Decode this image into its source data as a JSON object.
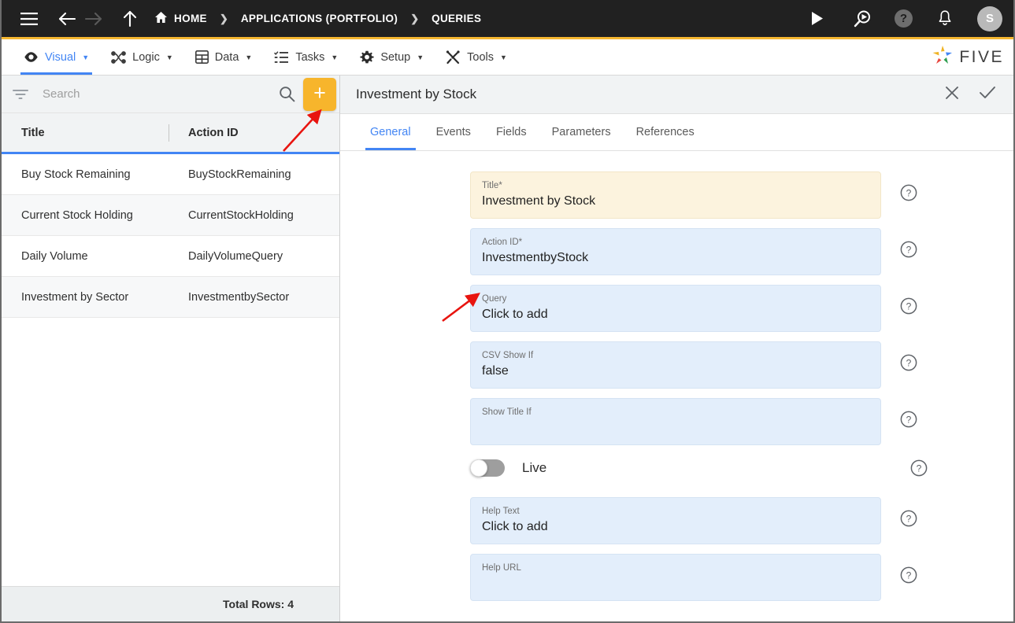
{
  "topbar": {
    "menu_icon": "hamburger-menu-icon",
    "back_icon": "arrow-left-icon",
    "forward_icon": "arrow-right-icon",
    "up_icon": "arrow-up-icon",
    "home_icon": "home-icon",
    "breadcrumbs": [
      {
        "label": "HOME",
        "icon": "home-icon"
      },
      {
        "label": "APPLICATIONS (PORTFOLIO)",
        "icon": ""
      },
      {
        "label": "QUERIES",
        "icon": ""
      }
    ],
    "separator": "❯",
    "actions": [
      {
        "name": "run-icon",
        "glyph": "▶"
      },
      {
        "name": "search-run-icon",
        "glyph": ""
      },
      {
        "name": "help-icon",
        "glyph": "?"
      },
      {
        "name": "notifications-bell-icon",
        "glyph": ""
      }
    ],
    "avatar_initial": "S"
  },
  "menubar": {
    "items": [
      {
        "label": "Visual",
        "icon": "eye-icon",
        "caret": "▼",
        "active": true
      },
      {
        "label": "Logic",
        "icon": "nodes-icon",
        "caret": "▼",
        "active": false
      },
      {
        "label": "Data",
        "icon": "table-icon",
        "caret": "▼",
        "active": false
      },
      {
        "label": "Tasks",
        "icon": "checklist-icon",
        "caret": "▼",
        "active": false
      },
      {
        "label": "Setup",
        "icon": "gear-icon",
        "caret": "▼",
        "active": false
      },
      {
        "label": "Tools",
        "icon": "tools-icon",
        "caret": "▼",
        "active": false
      }
    ],
    "brand": "FIVE",
    "accent_color": "#f5b731",
    "active_color": "#4285f4"
  },
  "sidebar": {
    "filter_icon": "filter-icon",
    "search_placeholder": "Search",
    "search_value": "",
    "search_icon": "search-icon",
    "add_button_label": "+",
    "add_button_color": "#f7b52c",
    "columns": [
      "Title",
      "Action ID"
    ],
    "rows": [
      {
        "title": "Buy Stock Remaining",
        "action_id": "BuyStockRemaining"
      },
      {
        "title": "Current Stock Holding",
        "action_id": "CurrentStockHolding"
      },
      {
        "title": "Daily Volume",
        "action_id": "DailyVolumeQuery"
      },
      {
        "title": "Investment by Sector",
        "action_id": "InvestmentbySector"
      }
    ],
    "footer": "Total Rows: 4"
  },
  "detail": {
    "title": "Investment by Stock",
    "close_icon": "close-icon",
    "confirm_icon": "check-icon",
    "tabs": [
      {
        "label": "General",
        "active": true
      },
      {
        "label": "Events",
        "active": false
      },
      {
        "label": "Fields",
        "active": false
      },
      {
        "label": "Parameters",
        "active": false
      },
      {
        "label": "References",
        "active": false
      }
    ],
    "fields": [
      {
        "label": "Title",
        "required": true,
        "value": "Investment by Stock",
        "highlight": true,
        "name": "title-field"
      },
      {
        "label": "Action ID",
        "required": true,
        "value": "InvestmentbyStock",
        "highlight": false,
        "name": "action-id-field"
      },
      {
        "label": "Query",
        "required": false,
        "value": "Click to add",
        "highlight": false,
        "name": "query-field"
      },
      {
        "label": "CSV Show If",
        "required": false,
        "value": "false",
        "highlight": false,
        "name": "csv-show-if-field"
      },
      {
        "label": "Show Title If",
        "required": false,
        "value": "",
        "highlight": false,
        "name": "show-title-if-field"
      }
    ],
    "toggle": {
      "label": "Live",
      "on": false,
      "name": "live-toggle"
    },
    "fields_after": [
      {
        "label": "Help Text",
        "required": false,
        "value": "Click to add",
        "highlight": false,
        "name": "help-text-field"
      },
      {
        "label": "Help URL",
        "required": false,
        "value": "",
        "highlight": false,
        "name": "help-url-field"
      }
    ],
    "help_icon": "help-circle-icon",
    "required_marker": "*"
  },
  "annotations": [
    {
      "name": "arrow-to-add-button",
      "color": "#e8140f"
    },
    {
      "name": "arrow-to-query-field",
      "color": "#e8140f"
    }
  ]
}
